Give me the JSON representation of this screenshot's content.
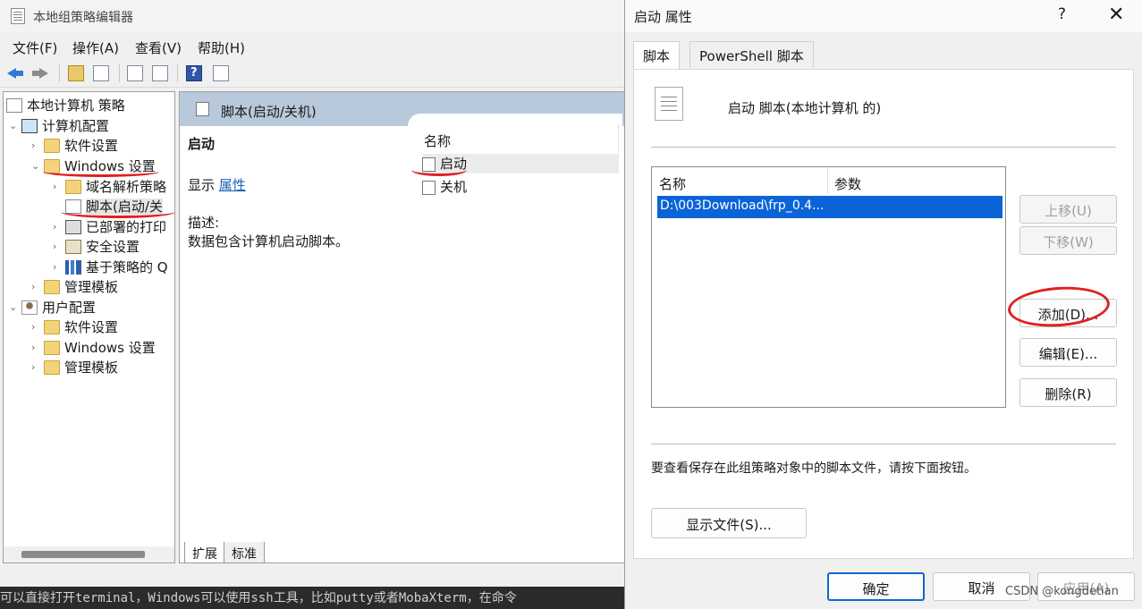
{
  "gp": {
    "title": "本地组策略编辑器",
    "menu": [
      "文件(F)",
      "操作(A)",
      "查看(V)",
      "帮助(H)"
    ],
    "tree": [
      {
        "label": "本地计算机 策略",
        "icon": "doc-icon"
      },
      {
        "label": "计算机配置",
        "icon": "computer-icon"
      },
      {
        "label": "软件设置",
        "icon": "folder-icon"
      },
      {
        "label": "Windows 设置",
        "icon": "folder-icon"
      },
      {
        "label": "域名解析策略",
        "icon": "folder-icon"
      },
      {
        "label": "脚本(启动/关",
        "icon": "script-icon"
      },
      {
        "label": "已部署的打印",
        "icon": "printer-icon"
      },
      {
        "label": "安全设置",
        "icon": "security-icon"
      },
      {
        "label": "基于策略的 Q",
        "icon": "chart-icon"
      },
      {
        "label": "管理模板",
        "icon": "folder-icon"
      },
      {
        "label": "用户配置",
        "icon": "user-icon"
      },
      {
        "label": "软件设置",
        "icon": "folder-icon"
      },
      {
        "label": "Windows 设置",
        "icon": "folder-icon"
      },
      {
        "label": "管理模板",
        "icon": "folder-icon"
      }
    ],
    "right_header": "脚本(启动/关机)",
    "section_title": "启动",
    "show_label": "显示",
    "show_link": "属性",
    "desc_label": "描述:",
    "desc_text": "数据包含计算机启动脚本。",
    "list_header": "名称",
    "list_items": [
      "启动",
      "关机"
    ],
    "tabs": [
      "扩展",
      "标准"
    ],
    "bottom_text": "可以直接打开terminal，Windows可以使用ssh工具，比如putty或者MobaXterm，在命令"
  },
  "dialog": {
    "title": "启动 属性",
    "help": "?",
    "close": "✕",
    "tabs": [
      "脚本",
      "PowerShell 脚本"
    ],
    "heading": "启动 脚本(本地计算机 的)",
    "columns": [
      "名称",
      "参数"
    ],
    "rows": [
      {
        "name": "D:\\003Download\\frp_0.4...",
        "params": ""
      }
    ],
    "buttons": {
      "up": "上移(U)",
      "down": "下移(W)",
      "add": "添加(D)...",
      "edit": "编辑(E)...",
      "delete": "删除(R)"
    },
    "note": "要查看保存在此组策略对象中的脚本文件，请按下面按钮。",
    "show_files": "显示文件(S)...",
    "ok": "确定",
    "cancel": "取消",
    "apply": "应用(A)"
  },
  "watermark": "CSDN @kongdetian",
  "colors": {
    "selection": "#0a64d8",
    "annotation": "#e02020",
    "header": "#b8c9dc"
  }
}
